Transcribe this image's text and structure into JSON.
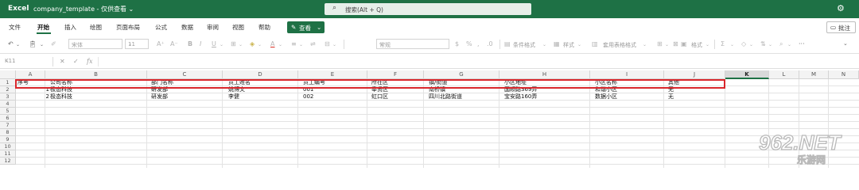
{
  "titlebar": {
    "app_name": "Excel",
    "document": "company_template  -  仅供查看  ⌄",
    "search_placeholder": "搜索(Alt + Q)",
    "search_icon": "search-icon",
    "settings_icon": "gear-icon",
    "background": "#1e7145"
  },
  "ribbon": {
    "tabs": [
      "文件",
      "开始",
      "插入",
      "绘图",
      "页面布局",
      "公式",
      "数据",
      "审阅",
      "视图",
      "帮助"
    ],
    "active_tab": "开始",
    "view_button": "查看",
    "comment_button": "批注"
  },
  "toolbar": {
    "font_name": "宋体",
    "font_size": "11",
    "number_format": "常规",
    "conditional_format": "条件格式",
    "styles": "样式",
    "table_format": "套用表格格式",
    "format": "格式",
    "sum_symbol": "Σ"
  },
  "formula_bar": {
    "name_box": "K11",
    "fx": "fx",
    "value": ""
  },
  "sheet": {
    "columns": [
      "A",
      "B",
      "C",
      "D",
      "E",
      "F",
      "G",
      "H",
      "I",
      "J",
      "K",
      "L",
      "M",
      "N"
    ],
    "selected_column": "K",
    "rows": [
      "1",
      "2",
      "3",
      "4",
      "5",
      "6",
      "7",
      "8",
      "9",
      "10",
      "11",
      "12"
    ],
    "header_row": [
      "序号",
      "公司名称",
      "部门名称",
      "员工姓名",
      "员工编号",
      "所在区",
      "镇/街道",
      "小区地址",
      "小区名称",
      "其他"
    ],
    "data_rows": [
      [
        "1",
        "极态科技",
        "研发部",
        "姚博文",
        "001",
        "奉贤区",
        "南桥镇",
        "国顺路369弄",
        "和谐小区",
        "无"
      ],
      [
        "2",
        "极态科技",
        "研发部",
        "李健",
        "002",
        "虹口区",
        "四川北路街道",
        "宝安路160弄",
        "数据小区",
        "无"
      ]
    ],
    "highlight_color": "#d9262b"
  },
  "watermark": {
    "text": "962.NET",
    "subtext": "乐游网"
  }
}
